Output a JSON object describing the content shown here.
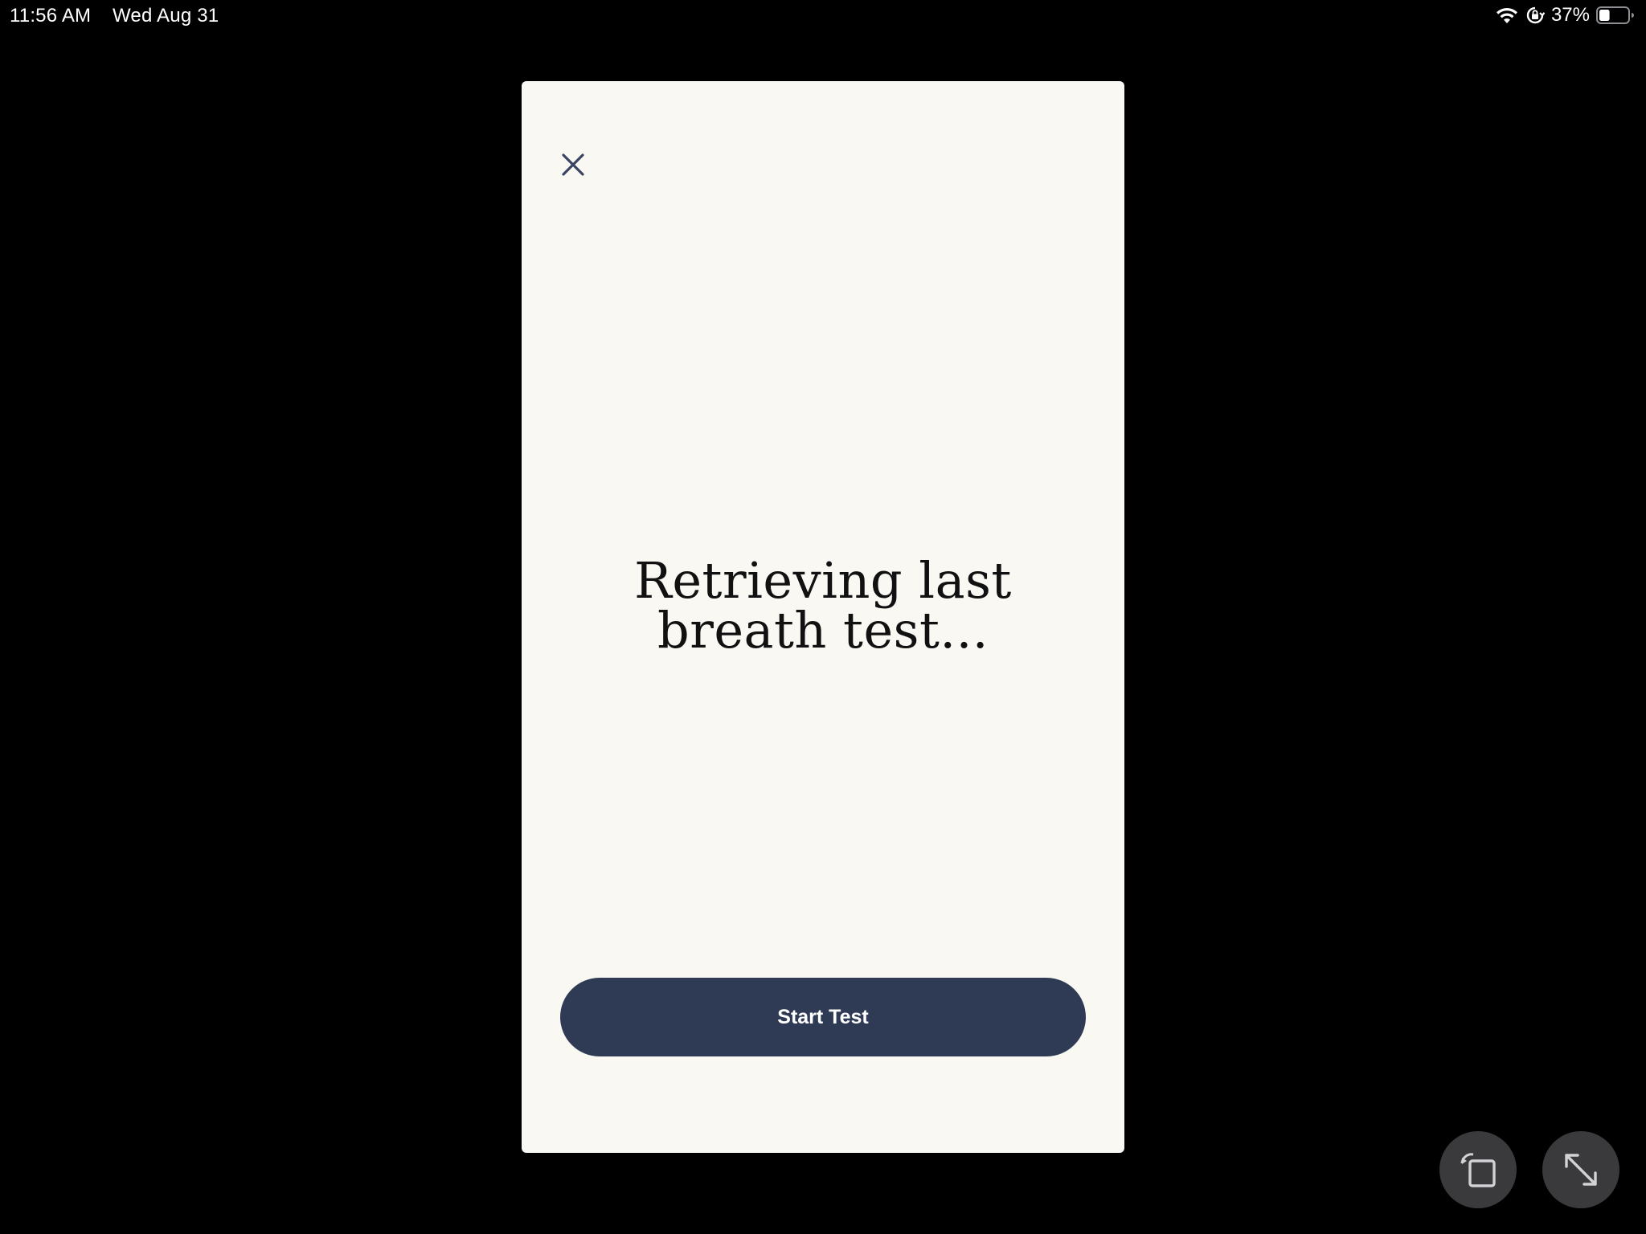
{
  "status_bar": {
    "time": "11:56 AM",
    "date": "Wed Aug 31",
    "battery_percent": "37%",
    "battery_level": 0.37,
    "icons": [
      "wifi-icon",
      "orientation-lock-icon",
      "battery-icon"
    ]
  },
  "app": {
    "close_icon": "close-icon",
    "loading_line1": "Retrieving last",
    "loading_line2": "breath test...",
    "start_button_label": "Start Test"
  },
  "controls": {
    "rotate_icon": "rotate-icon",
    "expand_icon": "expand-icon"
  },
  "colors": {
    "card_background": "#f9f8f3",
    "button_background": "#2f3b55",
    "close_icon_color": "#3b4563"
  }
}
